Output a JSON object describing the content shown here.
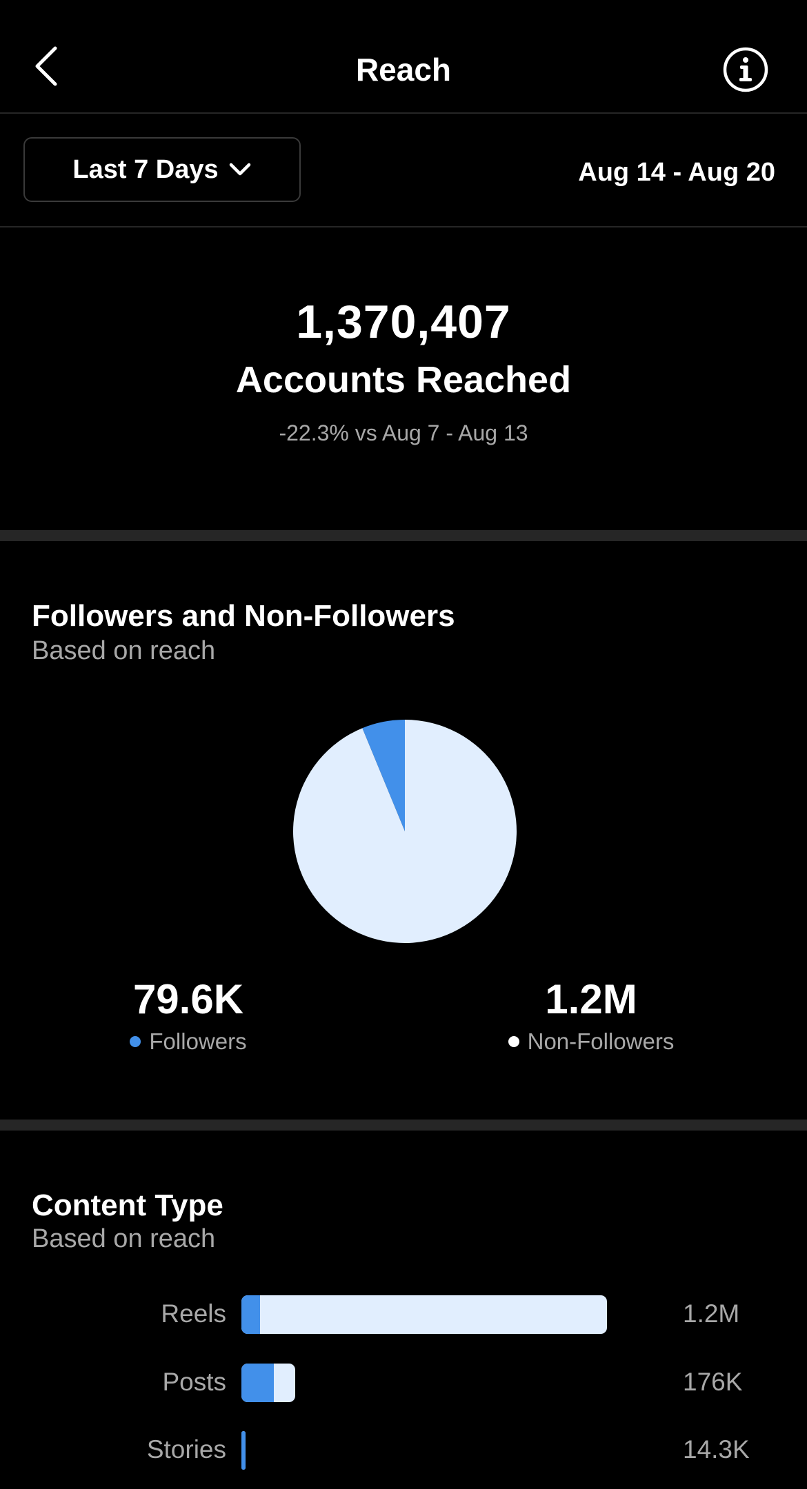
{
  "header": {
    "title": "Reach"
  },
  "filter": {
    "range_label": "Last 7 Days",
    "date_range": "Aug 14 - Aug 20"
  },
  "summary": {
    "accounts_reached": "1,370,407",
    "label": "Accounts Reached",
    "comparison": "-22.3% vs Aug 7 - Aug 13"
  },
  "followers_section": {
    "title": "Followers and Non-Followers",
    "subtitle": "Based on reach",
    "followers_value": "79.6K",
    "followers_label": "Followers",
    "non_followers_value": "1.2M",
    "non_followers_label": "Non-Followers"
  },
  "content_type": {
    "title": "Content Type",
    "subtitle": "Based on reach",
    "rows": [
      {
        "label": "Reels",
        "value": "1.2M"
      },
      {
        "label": "Posts",
        "value": "176K"
      },
      {
        "label": "Stories",
        "value": "14.3K"
      }
    ]
  },
  "colors": {
    "followers": "#4290ea",
    "non_followers": "#e1eefe"
  },
  "icons": {
    "back": "chevron-left-icon",
    "info": "info-icon",
    "dropdown": "chevron-down-icon"
  },
  "chart_data": [
    {
      "type": "pie",
      "title": "Followers and Non-Followers",
      "categories": [
        "Followers",
        "Non-Followers"
      ],
      "values": [
        79600,
        1200000
      ]
    },
    {
      "type": "bar",
      "title": "Content Type",
      "categories": [
        "Reels",
        "Posts",
        "Stories"
      ],
      "values": [
        1200000,
        176000,
        14300
      ],
      "follower_share": [
        0.05,
        0.6,
        1.0
      ]
    }
  ]
}
